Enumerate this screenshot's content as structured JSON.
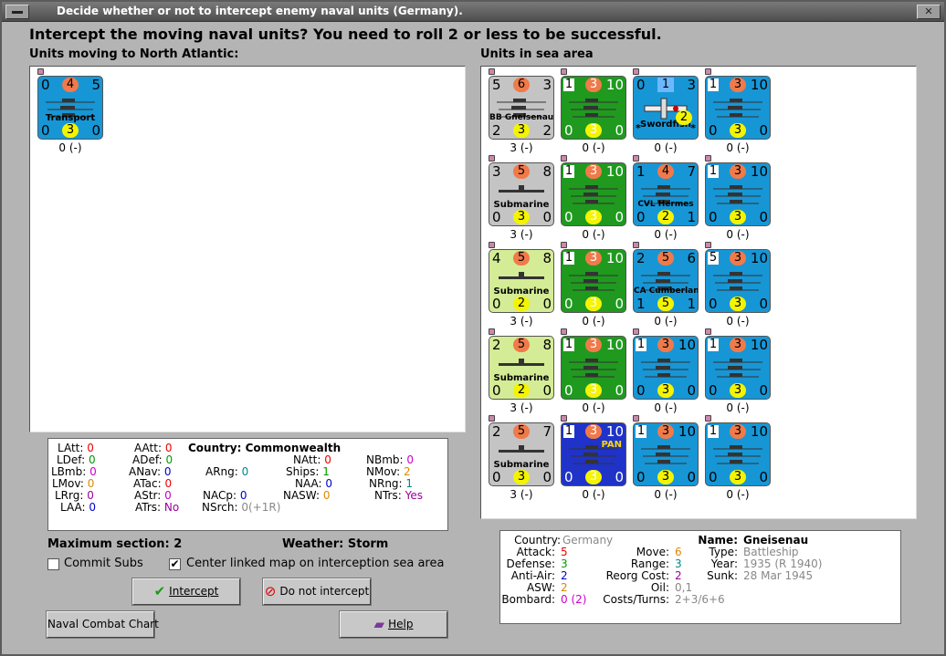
{
  "window": {
    "title": "Decide whether or not to intercept enemy naval units (Germany).",
    "close_glyph": "✕"
  },
  "headline": "Intercept the moving naval units?  You need to roll 2 or less to be successful.",
  "left_panel": {
    "label": "Units moving to North Atlantic:",
    "units": [
      {
        "color": "blue",
        "top_left": "0",
        "top_mid": "4",
        "top_right": "5",
        "name": "Transport",
        "bot_left": "0",
        "bot_mid": "3",
        "bot_right": "0",
        "label": "0 (-)"
      }
    ]
  },
  "right_panel": {
    "label": "Units in sea area",
    "rows": [
      [
        {
          "color": "grey",
          "tl": "5",
          "tm": "6",
          "tr": "3",
          "name": "BB Gneisenau",
          "bl": "2",
          "bm": "3",
          "br": "2",
          "label": "3 (-)"
        },
        {
          "color": "green",
          "tl": "1",
          "tm": "3",
          "tr": "10",
          "name": "",
          "bl": "0",
          "bm": "3",
          "br": "0",
          "label": "0 (-)"
        },
        {
          "color": "blue",
          "tl": "0",
          "tm": "1",
          "tr": "3",
          "name": "Swordfish",
          "bl": "",
          "bm": "2",
          "br": "",
          "label": "0 (-)"
        },
        {
          "color": "blue",
          "tl": "1",
          "tm": "3",
          "tr": "10",
          "name": "",
          "bl": "0",
          "bm": "3",
          "br": "0",
          "label": "0 (-)"
        }
      ],
      [
        {
          "color": "grey",
          "tl": "3",
          "tm": "5",
          "tr": "8",
          "name": "Submarine",
          "bl": "0",
          "bm": "3",
          "br": "0",
          "label": "3 (-)"
        },
        {
          "color": "green",
          "tl": "1",
          "tm": "3",
          "tr": "10",
          "name": "",
          "bl": "0",
          "bm": "3",
          "br": "0",
          "label": "0 (-)"
        },
        {
          "color": "blue",
          "tl": "1",
          "tm": "4",
          "tr": "7",
          "name": "CVL Hermes",
          "bl": "0",
          "bm": "2",
          "br": "1",
          "label": "0 (-)"
        },
        {
          "color": "blue",
          "tl": "1",
          "tm": "3",
          "tr": "10",
          "name": "",
          "bl": "0",
          "bm": "3",
          "br": "0",
          "label": "0 (-)"
        }
      ],
      [
        {
          "color": "lime",
          "tl": "4",
          "tm": "5",
          "tr": "8",
          "name": "Submarine",
          "bl": "0",
          "bm": "2",
          "br": "0",
          "label": "3 (-)"
        },
        {
          "color": "green",
          "tl": "1",
          "tm": "3",
          "tr": "10",
          "name": "",
          "bl": "0",
          "bm": "3",
          "br": "0",
          "label": "0 (-)"
        },
        {
          "color": "blue",
          "tl": "2",
          "tm": "5",
          "tr": "6",
          "name": "CA Cumberland",
          "bl": "1",
          "bm": "5",
          "br": "1",
          "label": "0 (-)"
        },
        {
          "color": "blue",
          "tl": "5",
          "tm": "3",
          "tr": "10",
          "name": "",
          "bl": "0",
          "bm": "3",
          "br": "0",
          "label": "0 (-)"
        }
      ],
      [
        {
          "color": "lime",
          "tl": "2",
          "tm": "5",
          "tr": "8",
          "name": "Submarine",
          "bl": "0",
          "bm": "2",
          "br": "0",
          "label": "3 (-)"
        },
        {
          "color": "green",
          "tl": "1",
          "tm": "3",
          "tr": "10",
          "name": "",
          "bl": "0",
          "bm": "3",
          "br": "0",
          "label": "0 (-)"
        },
        {
          "color": "blue",
          "tl": "1",
          "tm": "3",
          "tr": "10",
          "name": "",
          "bl": "0",
          "bm": "3",
          "br": "0",
          "label": "0 (-)"
        },
        {
          "color": "blue",
          "tl": "1",
          "tm": "3",
          "tr": "10",
          "name": "",
          "bl": "0",
          "bm": "3",
          "br": "0",
          "label": "0 (-)"
        }
      ],
      [
        {
          "color": "grey",
          "tl": "2",
          "tm": "5",
          "tr": "7",
          "name": "Submarine",
          "bl": "0",
          "bm": "3",
          "br": "0",
          "label": "3 (-)"
        },
        {
          "color": "navy",
          "tl": "1",
          "tm": "3",
          "tr": "10",
          "name": "PAN",
          "bl": "0",
          "bm": "3",
          "br": "0",
          "label": "0 (-)"
        },
        {
          "color": "blue",
          "tl": "1",
          "tm": "3",
          "tr": "10",
          "name": "",
          "bl": "0",
          "bm": "3",
          "br": "0",
          "label": "0 (-)"
        },
        {
          "color": "blue",
          "tl": "1",
          "tm": "3",
          "tr": "10",
          "name": "",
          "bl": "0",
          "bm": "3",
          "br": "0",
          "label": "0 (-)"
        }
      ]
    ]
  },
  "stats": {
    "country_label": "Country:",
    "country": "Commonwealth",
    "latt_k": "LAtt:",
    "latt": "0",
    "ldef_k": "LDef:",
    "ldef": "0",
    "lbmb_k": "LBmb:",
    "lbmb": "0",
    "lmov_k": "LMov:",
    "lmov": "0",
    "lrg_k": "LRrg:",
    "lrg": "0",
    "laa_k": "LAA:",
    "laa": "0",
    "aatt_k": "AAtt:",
    "aatt": "0",
    "adef_k": "ADef:",
    "adef": "0",
    "anav_k": "ANav:",
    "anav": "0",
    "atac_k": "ATac:",
    "atac": "0",
    "astr_k": "AStr:",
    "astr": "0",
    "atrs_k": "ATrs:",
    "atrs": "No",
    "arng_k": "ARng:",
    "arng": "0",
    "nacp_k": "NACp:",
    "nacp": "0",
    "nsrch_k": "NSrch:",
    "nsrch": "0(+1R)",
    "natt_k": "NAtt:",
    "natt": "0",
    "ships_k": "Ships:",
    "ships": "1",
    "naa_k": "NAA:",
    "naa": "0",
    "nasw_k": "NASW:",
    "nasw": "0",
    "nbmb_k": "NBmb:",
    "nbmb": "0",
    "nmov_k": "NMov:",
    "nmov": "2",
    "nrng_k": "NRng:",
    "nrng": "1",
    "ntrs_k": "NTrs:",
    "ntrs": "Yes"
  },
  "max_section": "Maximum section: 2",
  "weather": "Weather:  Storm",
  "commit_subs": {
    "label": "Commit Subs",
    "checked": false
  },
  "center_map": {
    "label": "Center linked map on interception sea area",
    "checked": true
  },
  "buttons": {
    "intercept": "Intercept",
    "no_intercept": "Do not intercept",
    "chart": "Naval Combat Chart",
    "help": "Help"
  },
  "info": {
    "country_k": "Country:",
    "country": "Germany",
    "attack_k": "Attack:",
    "attack": "5",
    "defense_k": "Defense:",
    "defense": "3",
    "antiair_k": "Anti-Air:",
    "antiair": "2",
    "asw_k": "ASW:",
    "asw": "2",
    "bombard_k": "Bombard:",
    "bombard": "0 (2)",
    "move_k": "Move:",
    "move": "6",
    "range_k": "Range:",
    "range": "3",
    "reorg_k": "Reorg Cost:",
    "reorg": "2",
    "oil_k": "Oil:",
    "oil": "0,1",
    "costs_k": "Costs/Turns:",
    "costs": "2+3/6+6",
    "name_k": "Name:",
    "name": "Gneisenau",
    "type_k": "Type:",
    "type": "Battleship",
    "year_k": "Year:",
    "year": "1935 (R 1940)",
    "sunk_k": "Sunk:",
    "sunk": "28 Mar 1945"
  },
  "colors": {
    "grey": "#c4c4c4",
    "blue": "#1796d6",
    "green": "#1f9a1f",
    "lime": "#d4ec96",
    "navy": "#1f33c8"
  },
  "icons": [
    "ok-check-icon",
    "no-entry-icon",
    "help-book-icon",
    "ship-silhouette-icon",
    "aircraft-icon"
  ]
}
